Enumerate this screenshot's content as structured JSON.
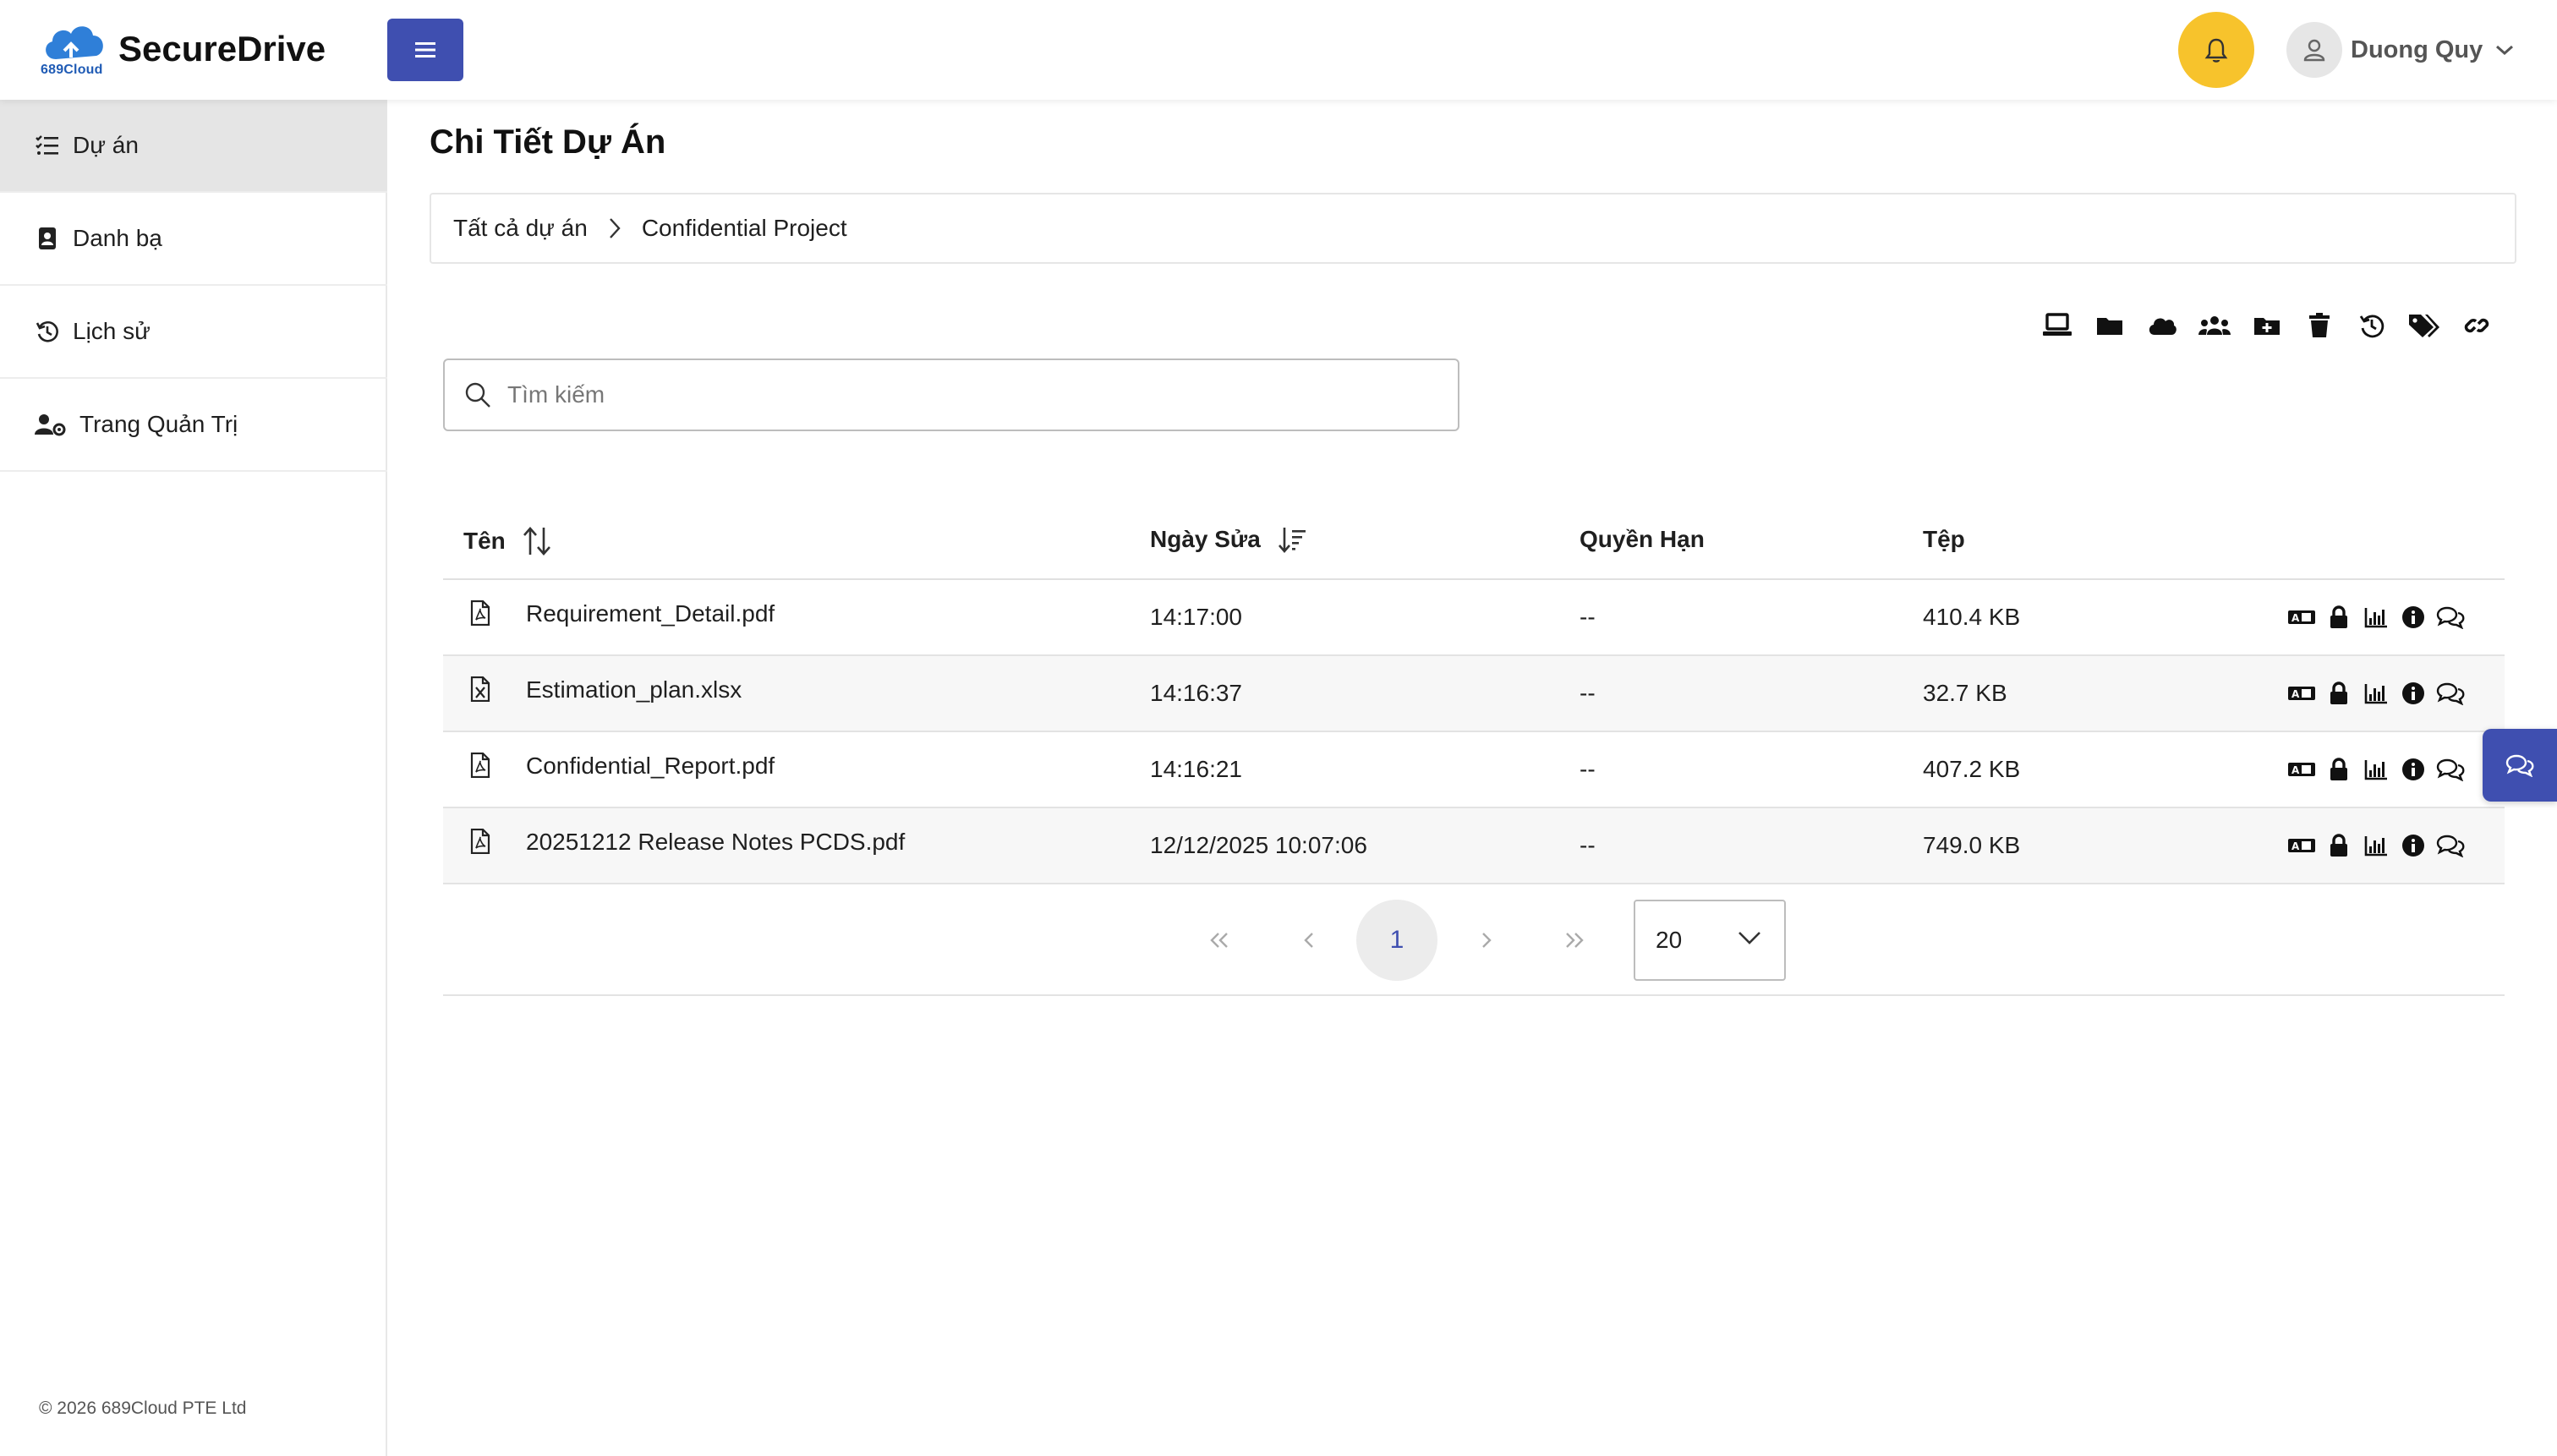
{
  "header": {
    "brand": "SecureDrive",
    "logo_text": "689Cloud",
    "user_name": "Duong Quy"
  },
  "sidebar": {
    "items": [
      {
        "label": "Dự án",
        "icon": "list-check-icon"
      },
      {
        "label": "Danh bạ",
        "icon": "address-book-icon"
      },
      {
        "label": "Lịch sử",
        "icon": "history-icon"
      },
      {
        "label": "Trang Quản Trị",
        "icon": "users-cog-icon"
      }
    ],
    "footer": "© 2026 689Cloud PTE Ltd"
  },
  "main": {
    "title": "Chi Tiết Dự Án",
    "breadcrumb": [
      "Tất cả dự án",
      "Confidential Project"
    ],
    "search_placeholder": "Tìm kiếm",
    "columns": {
      "name": "Tên",
      "modified": "Ngày Sửa",
      "permission": "Quyền Hạn",
      "file": "Tệp"
    },
    "files": [
      {
        "name": "Requirement_Detail.pdf",
        "modified": "14:17:00",
        "permission": "--",
        "size": "410.4 KB",
        "type": "pdf"
      },
      {
        "name": "Estimation_plan.xlsx",
        "modified": "14:16:37",
        "permission": "--",
        "size": "32.7 KB",
        "type": "excel"
      },
      {
        "name": "Confidential_Report.pdf",
        "modified": "14:16:21",
        "permission": "--",
        "size": "407.2 KB",
        "type": "pdf"
      },
      {
        "name": "20251212 Release Notes PCDS.pdf",
        "modified": "12/12/2025 10:07:06",
        "permission": "--",
        "size": "749.0 KB",
        "type": "pdf"
      }
    ],
    "pagination": {
      "current_page": "1",
      "page_size": "20"
    }
  },
  "colors": {
    "primary": "#3f4fb0",
    "bell": "#f7c32c",
    "active_nav": "#e5e5e5"
  }
}
